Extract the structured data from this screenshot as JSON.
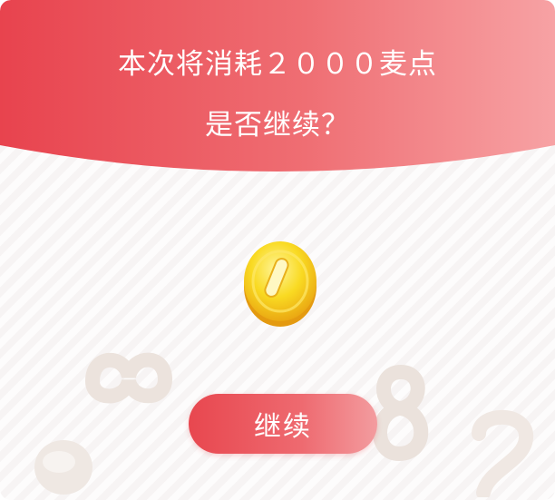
{
  "dialog": {
    "message_line1": "本次将消耗２０００麦点",
    "message_line2": "是否继续？",
    "continue_label": "继续",
    "colors": {
      "header_start": "#e8434e",
      "header_end": "#f7a2a4",
      "button_start": "#e8474f",
      "button_end": "#f39c9f",
      "coin": "#f7d51e"
    },
    "icons": [
      "coin-icon",
      "decorative-number-icon"
    ]
  }
}
